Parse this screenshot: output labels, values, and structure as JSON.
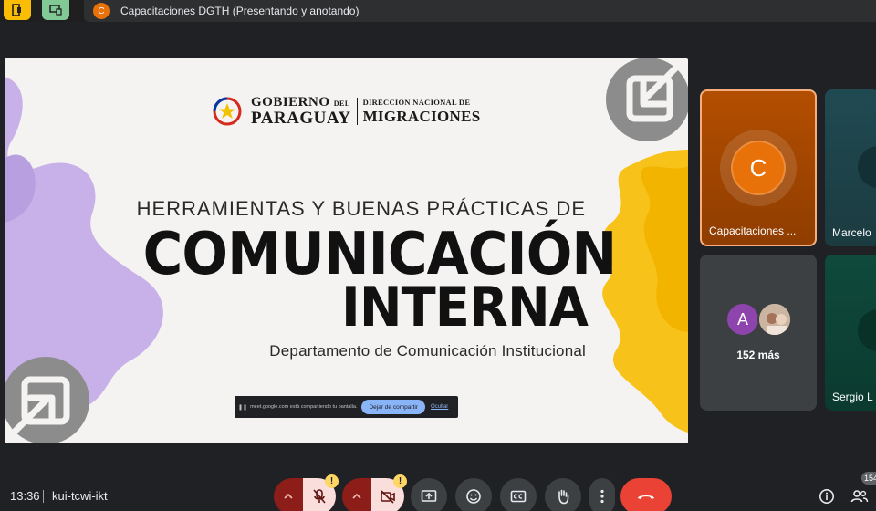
{
  "top_bar": {
    "avatar_letter": "C",
    "meeting_title": "Capacitaciones DGTH (Presentando y anotando)"
  },
  "slide": {
    "logo": {
      "gobierno": "GOBIERNO",
      "del": "DEL",
      "paraguay": "PARAGUAY",
      "direccion": "DIRECCIÓN NACIONAL DE",
      "migraciones": "MIGRACIONES"
    },
    "subtitle": "HERRAMIENTAS Y BUENAS PRÁCTICAS DE",
    "title_line1": "COMUNICACIÓN",
    "title_line2": "INTERNA",
    "department": "Departamento de Comunicación Institucional",
    "share_notice": {
      "text": "meet.google.com está compartiendo tu pantalla.",
      "stop_label": "Dejar de compartir",
      "hide_label": "Ocultar"
    },
    "colors": {
      "lavender": "#c7b1e8",
      "yellow": "#f7c21a",
      "grey": "#8c8c8c"
    }
  },
  "tiles": {
    "main": {
      "avatar_letter": "C",
      "name": "Capacitaciones ..."
    },
    "marcelo": {
      "name": "Marcelo"
    },
    "more": {
      "avatar_letter": "A",
      "count_label": "152 más"
    },
    "sergio": {
      "name": "Sergio L"
    }
  },
  "bottom_bar": {
    "time": "13:36",
    "meeting_code": "kui-tcwi-ikt",
    "warning_symbol": "!",
    "people_count": "154"
  },
  "icons": [
    "door-exit-icon",
    "screen-cast-icon",
    "chevron-up-icon",
    "mic-off-icon",
    "camera-off-icon",
    "present-icon",
    "emoji-icon",
    "captions-icon",
    "raise-hand-icon",
    "more-vert-icon",
    "call-end-icon",
    "info-icon",
    "people-icon"
  ]
}
